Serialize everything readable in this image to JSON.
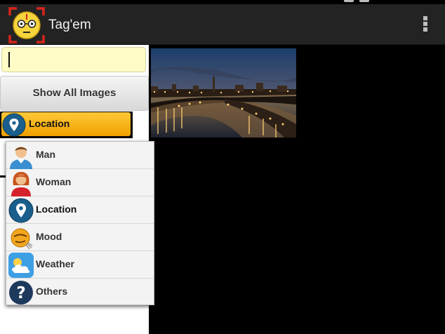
{
  "app": {
    "title": "Tag'em"
  },
  "search": {
    "value": ""
  },
  "show_all_label": "Show All Images",
  "selector": {
    "label": "Location",
    "icon": "location-pin-icon"
  },
  "dropdown": {
    "items": [
      {
        "label": "Man",
        "icon": "man-avatar-icon"
      },
      {
        "label": "Woman",
        "icon": "woman-avatar-icon"
      },
      {
        "label": "Location",
        "icon": "location-pin-icon"
      },
      {
        "label": "Mood",
        "icon": "mood-face-icon"
      },
      {
        "label": "Weather",
        "icon": "weather-cloud-icon"
      },
      {
        "label": "Others",
        "icon": "question-mark-icon"
      }
    ]
  },
  "colors": {
    "accent": "#f0a000",
    "actionbar": "#232323",
    "search_bg": "#fffcc6",
    "pin": "#1a5f8c"
  },
  "images": [
    {
      "subject": "city river at night"
    }
  ]
}
